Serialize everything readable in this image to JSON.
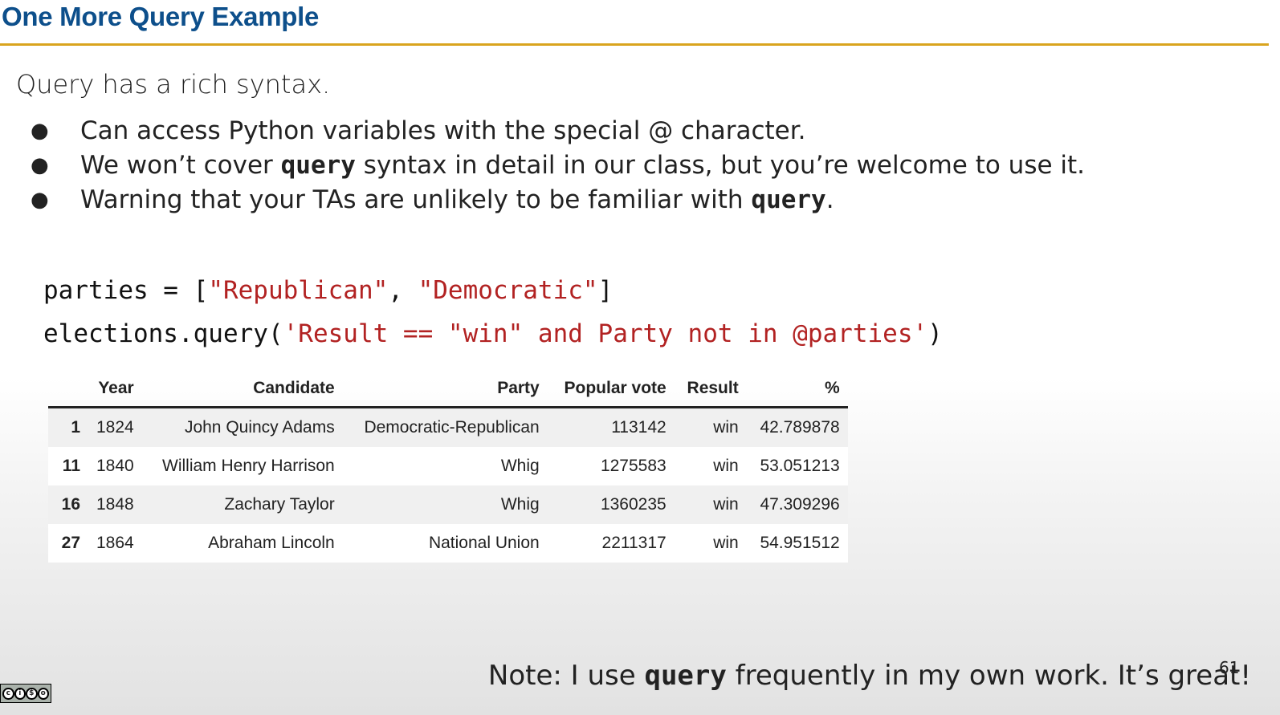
{
  "slide": {
    "title": "One More Query Example",
    "intro": "Query has a rich syntax.",
    "bullets": [
      {
        "before": "Can access Python variables with the special @ character.",
        "code": "",
        "after": ""
      },
      {
        "before": "We won’t cover ",
        "code": "query",
        "after": " syntax in detail in our class, but you’re welcome to use it."
      },
      {
        "before": "Warning that your TAs are unlikely to be familiar with ",
        "code": "query",
        "after": "."
      }
    ],
    "bullet_symbol": "●",
    "code": {
      "line1": {
        "p1": "parties = [",
        "s1": "\"Republican\"",
        "p2": ", ",
        "s2": "\"Democratic\"",
        "p3": "]"
      },
      "line2": {
        "p1": "elections.query(",
        "s1": "'Result == \"win\" and Party not in @parties'",
        "p2": ")"
      }
    },
    "table": {
      "headers": [
        "",
        "Year",
        "Candidate",
        "Party",
        "Popular vote",
        "Result",
        "%"
      ],
      "rows": [
        [
          "1",
          "1824",
          "John Quincy Adams",
          "Democratic-Republican",
          "113142",
          "win",
          "42.789878"
        ],
        [
          "11",
          "1840",
          "William Henry Harrison",
          "Whig",
          "1275583",
          "win",
          "53.051213"
        ],
        [
          "16",
          "1848",
          "Zachary Taylor",
          "Whig",
          "1360235",
          "win",
          "47.309296"
        ],
        [
          "27",
          "1864",
          "Abraham Lincoln",
          "National Union",
          "2211317",
          "win",
          "54.951512"
        ]
      ]
    },
    "note": {
      "before": "Note: I use ",
      "code": "query",
      "after": " frequently in my own work. It’s great!"
    },
    "page_number": "61",
    "license_icon": "creative-commons-by-nc-sa",
    "colors": {
      "title": "#0d4f8b",
      "rule": "#d9a41e",
      "string": "#b22222"
    }
  }
}
